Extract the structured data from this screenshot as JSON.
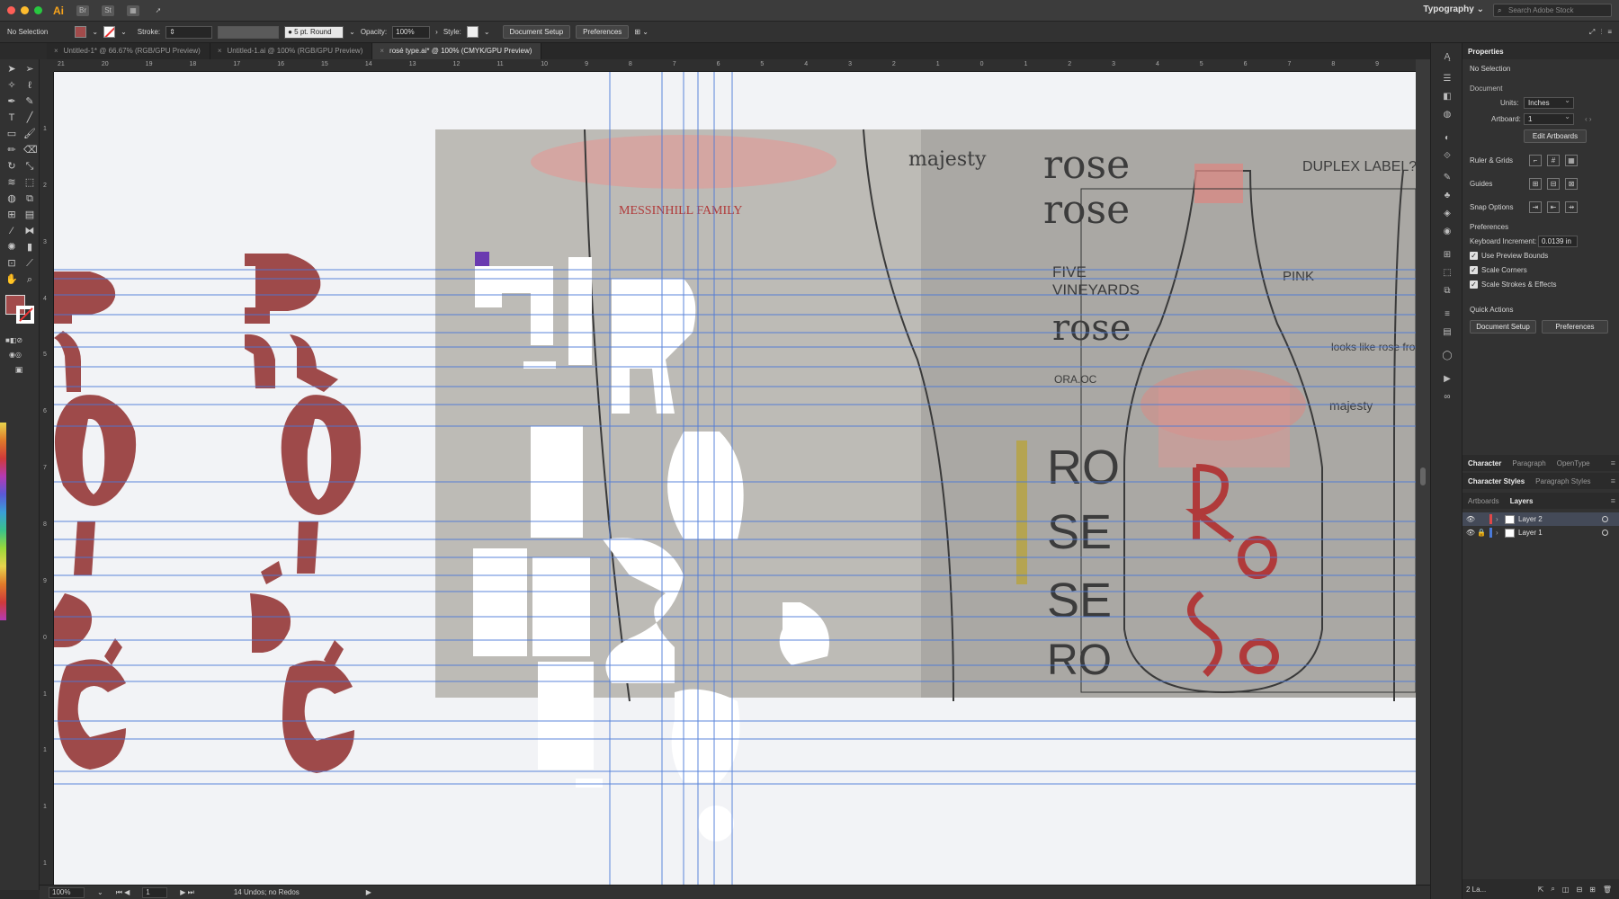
{
  "app": {
    "logo": "Ai",
    "workspace": "Typography",
    "stock_search_placeholder": "Search Adobe Stock",
    "traffic_colors": [
      "#fe5f57",
      "#febc2e",
      "#28c840"
    ]
  },
  "control": {
    "selection": "No Selection",
    "stroke_label": "Stroke:",
    "brush": "5 pt. Round",
    "opacity_label": "Opacity:",
    "opacity": "100%",
    "style_label": "Style:",
    "document_setup": "Document Setup",
    "preferences": "Preferences"
  },
  "tabs": [
    {
      "label": "Untitled-1* @ 66.67% (RGB/GPU Preview)"
    },
    {
      "label": "Untitled-1.ai @ 100% (RGB/GPU Preview)"
    },
    {
      "label": "rosé type.ai* @ 100% (CMYK/GPU Preview)"
    }
  ],
  "ruler": {
    "h_ticks": [
      "21",
      "20",
      "19",
      "18",
      "17",
      "16",
      "15",
      "14",
      "13",
      "12",
      "11",
      "10",
      "9",
      "8",
      "7",
      "6",
      "5",
      "4",
      "3",
      "2",
      "1",
      "0",
      "1",
      "2",
      "3",
      "4",
      "5",
      "6",
      "7",
      "8",
      "9"
    ],
    "v_ticks": [
      "1",
      "2",
      "3",
      "4",
      "5",
      "6",
      "7",
      "8",
      "9",
      "0",
      "1",
      "1",
      "1",
      "1"
    ]
  },
  "sketch": {
    "note_majesty": "majesty",
    "note_duplex": "DUPLEX LABEL?",
    "note_rose1": "rose",
    "note_rose2": "rose",
    "note_five": "FIVE",
    "note_vineyards": "VINEYARDS",
    "note_rose3": "rose",
    "note_orange": "ORA.OC",
    "note_pink": "PINK",
    "note_looks": "looks like rose from above",
    "note_majesty2": "majesty",
    "note_family": "MESSINHILL FAMILY",
    "note_ro": "RO",
    "note_se": "SE",
    "note_se2": "SE",
    "note_ro2": "RO"
  },
  "colors": {
    "glyph": "#9e4a4a",
    "guide": "#4a78d8",
    "fill": "#a24b4b"
  },
  "status": {
    "zoom": "100%",
    "artboard": "1",
    "history": "14 Undos; no Redos"
  },
  "panel": {
    "properties_tab": "Properties",
    "selection": "No Selection",
    "document_heading": "Document",
    "units_label": "Units:",
    "units": "Inches",
    "artboard_label": "Artboard:",
    "artboard": "1",
    "edit_artboards": "Edit Artboards",
    "ruler_grids": "Ruler & Grids",
    "guides": "Guides",
    "snap_options": "Snap Options",
    "preferences_heading": "Preferences",
    "keyboard_increment_label": "Keyboard Increment:",
    "keyboard_increment": "0.0139 in",
    "use_preview_bounds": "Use Preview Bounds",
    "scale_corners": "Scale Corners",
    "scale_strokes": "Scale Strokes & Effects",
    "quick_actions": "Quick Actions",
    "document_setup": "Document Setup",
    "preferences": "Preferences",
    "char_tabs": [
      "Character",
      "Paragraph",
      "OpenType"
    ],
    "style_tabs": [
      "Character Styles",
      "Paragraph Styles"
    ],
    "layer_tabs": [
      "Artboards",
      "Layers"
    ],
    "layers": [
      {
        "name": "Layer 2",
        "color": "#e04848",
        "selected": true
      },
      {
        "name": "Layer 1",
        "color": "#4a7ad8",
        "selected": false
      }
    ],
    "footer": "2 La..."
  }
}
